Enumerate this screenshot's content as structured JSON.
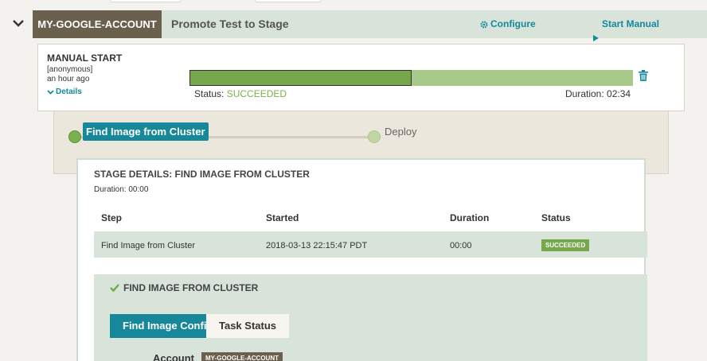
{
  "header": {
    "account": "MY-GOOGLE-ACCOUNT",
    "pipeline_name": "Promote Test to Stage",
    "configure_label": "Configure",
    "start_manual_label": "Start Manual Execution"
  },
  "execution": {
    "trigger": "MANUAL START",
    "user": "[anonymous]",
    "time_ago": "an hour ago",
    "details_label": "Details",
    "progress": 0.5,
    "status_label": "Status:",
    "status_value": "SUCCEEDED",
    "duration_label": "Duration:",
    "duration_value": "02:34"
  },
  "graph": {
    "stages": [
      {
        "label": "Find Image from Cluster",
        "active": true
      },
      {
        "label": "Deploy",
        "active": false
      }
    ]
  },
  "stage_details": {
    "title": "STAGE DETAILS: FIND IMAGE FROM CLUSTER",
    "duration_label": "Duration:",
    "duration_value": "00:00",
    "columns": [
      "Step",
      "Started",
      "Duration",
      "Status"
    ],
    "rows": [
      {
        "step": "Find Image from Cluster",
        "started": "2018-03-13 22:15:47 PDT",
        "duration": "00:00",
        "status": "SUCCEEDED"
      }
    ]
  },
  "task": {
    "title": "FIND IMAGE FROM CLUSTER",
    "tabs": [
      "Find Image Config",
      "Task Status"
    ],
    "account_label": "Account",
    "account_value": "MY-GOOGLE-ACCOUNT"
  },
  "colors": {
    "brand_teal": "#17889a",
    "success_green": "#76a84b",
    "account_brown": "#6b5f4d"
  },
  "icons": {
    "collapse": "chevron-down-icon",
    "configure": "gear-icon",
    "start": "play-icon",
    "details": "chevron-down-icon",
    "delete": "trash-icon",
    "task_done": "check-icon"
  }
}
